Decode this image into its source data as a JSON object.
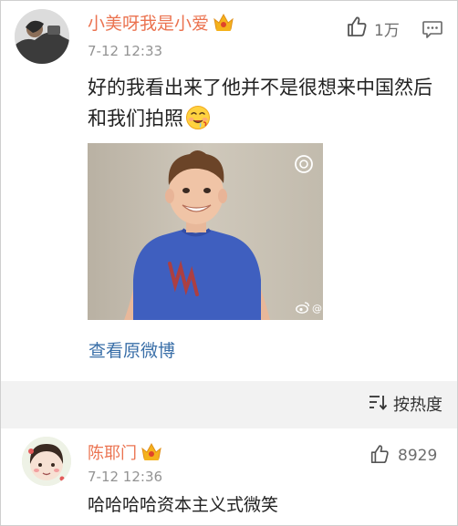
{
  "comments": [
    {
      "username": "小美呀我是小爱",
      "badge_icon": "crown-badge-icon",
      "timestamp": "7-12 12:33",
      "like_count": "1万",
      "text": "好的我看出来了他并不是很想来中国然后和我们拍照",
      "emoji_icon": "drooling-face-emoji-icon",
      "media": {
        "type": "video",
        "watermark_prefix": "@",
        "view_original_label": "查看原微博"
      }
    },
    {
      "username": "陈耶门",
      "badge_icon": "crown-badge-icon",
      "timestamp": "7-12 12:36",
      "like_count": "8929",
      "text": "哈哈哈哈资本主义式微笑"
    }
  ],
  "sort": {
    "label": "按热度"
  },
  "colors": {
    "username": "#eb7350",
    "link": "#3a6fa8",
    "timestamp": "#939393",
    "sort_bar_bg": "#f2f2f2"
  }
}
